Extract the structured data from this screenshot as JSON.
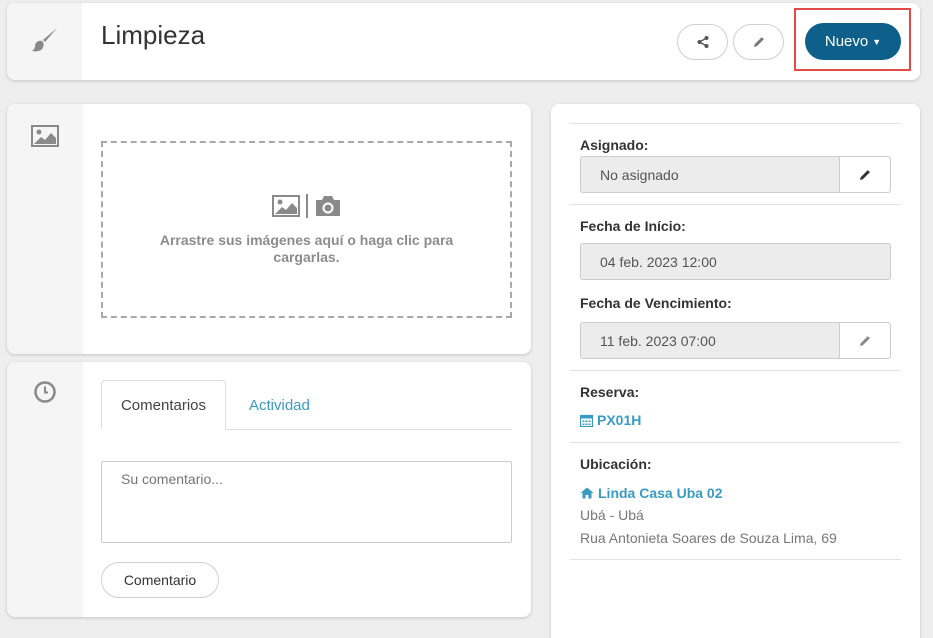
{
  "header": {
    "title": "Limpieza",
    "new_button_label": "Nuevo"
  },
  "image_upload": {
    "instructions": "Arrastre sus imágenes aquí o haga clic para cargarlas."
  },
  "comments": {
    "tabs": [
      {
        "label": "Comentarios",
        "active": true
      },
      {
        "label": "Actividad",
        "active": false
      }
    ],
    "placeholder": "Su comentario...",
    "submit_label": "Comentario"
  },
  "details": {
    "assigned": {
      "label": "Asignado:",
      "value": "No asignado"
    },
    "start_date": {
      "label": "Fecha de Início:",
      "value": "04 feb. 2023 12:00"
    },
    "due_date": {
      "label": "Fecha de Vencimiento:",
      "value": "11 feb. 2023 07:00"
    },
    "reservation": {
      "label": "Reserva:",
      "code": "PX01H"
    },
    "location": {
      "label": "Ubicación:",
      "name": "Linda Casa Uba 02",
      "city": "Ubá - Ubá",
      "address": "Rua Antonieta Soares de Souza Lima, 69"
    }
  },
  "colors": {
    "primary": "#0e5f8a",
    "link": "#3a9bc1",
    "highlight": "#e24a4a"
  },
  "icons": {
    "task_type": "paintbrush-icon",
    "share": "share-icon",
    "edit": "pencil-icon",
    "image": "image-icon",
    "camera": "camera-icon",
    "history": "clock-icon",
    "calendar": "calendar-icon",
    "home": "home-icon"
  }
}
